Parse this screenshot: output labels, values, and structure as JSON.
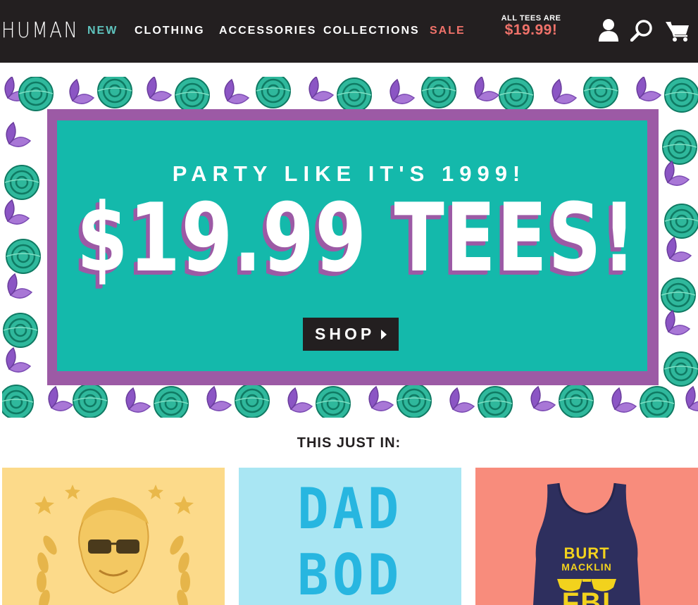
{
  "header": {
    "logo": "HUMAN",
    "nav": [
      {
        "label": "NEW",
        "color": "#5fc3bd"
      },
      {
        "label": "CLOTHING",
        "color": "#ffffff"
      },
      {
        "label": "ACCESSORIES",
        "color": "#ffffff"
      },
      {
        "label": "COLLECTIONS",
        "color": "#ffffff"
      },
      {
        "label": "SALE",
        "color": "#f0726a"
      }
    ],
    "promo_top": "ALL TEES ARE",
    "promo_price": "$19.99!",
    "icons": [
      "account-icon",
      "search-icon",
      "cart-icon"
    ]
  },
  "hero": {
    "subtitle": "PARTY LIKE IT'S 1999!",
    "headline": "$19.99 TEES!",
    "button_label": "SHOP",
    "colors": {
      "panel": "#14b9ab",
      "frame": "#9c5aa5",
      "button": "#231f20"
    }
  },
  "section": {
    "title": "THIS JUST IN:",
    "products": [
      {
        "background": "#fcda8a"
      },
      {
        "background": "#a9e6f3",
        "line1": "DAD",
        "line2": "BOD"
      },
      {
        "background": "#f88c7c",
        "line1": "BURT",
        "line2": "MACKLIN",
        "line3": "FBI"
      }
    ]
  },
  "colors": {
    "header_bg": "#231f20",
    "accent_teal": "#5fc3bd",
    "accent_coral": "#f0726a"
  }
}
